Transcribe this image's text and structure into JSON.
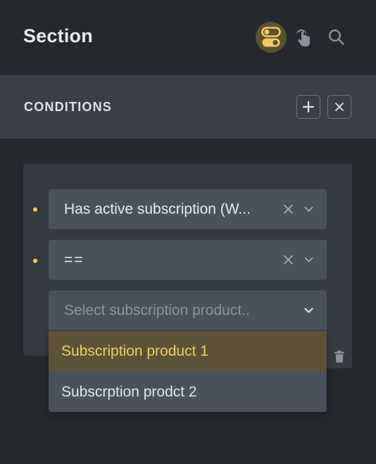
{
  "header": {
    "title": "Section",
    "icons": [
      "toggles-icon",
      "hand-pointer-icon",
      "search-icon"
    ],
    "active_icon": "toggles-icon"
  },
  "conditions": {
    "title": "CONDITIONS",
    "add_icon": "plus-icon",
    "close_icon": "close-icon"
  },
  "condition": {
    "key": "Has active subscription (W...",
    "operator": "==",
    "value_placeholder": "Select subscription product..",
    "options": [
      "Subscription product 1",
      "Subscrption prodct 2"
    ],
    "highlighted_option": "Subscription product 1",
    "delete_icon": "trash-icon"
  },
  "colors": {
    "background": "#25282d",
    "panel": "#3a3f47",
    "card": "#353a41",
    "field": "#4b515b",
    "accent": "#f1cb5c",
    "highlight_bg": "#5d5237"
  }
}
